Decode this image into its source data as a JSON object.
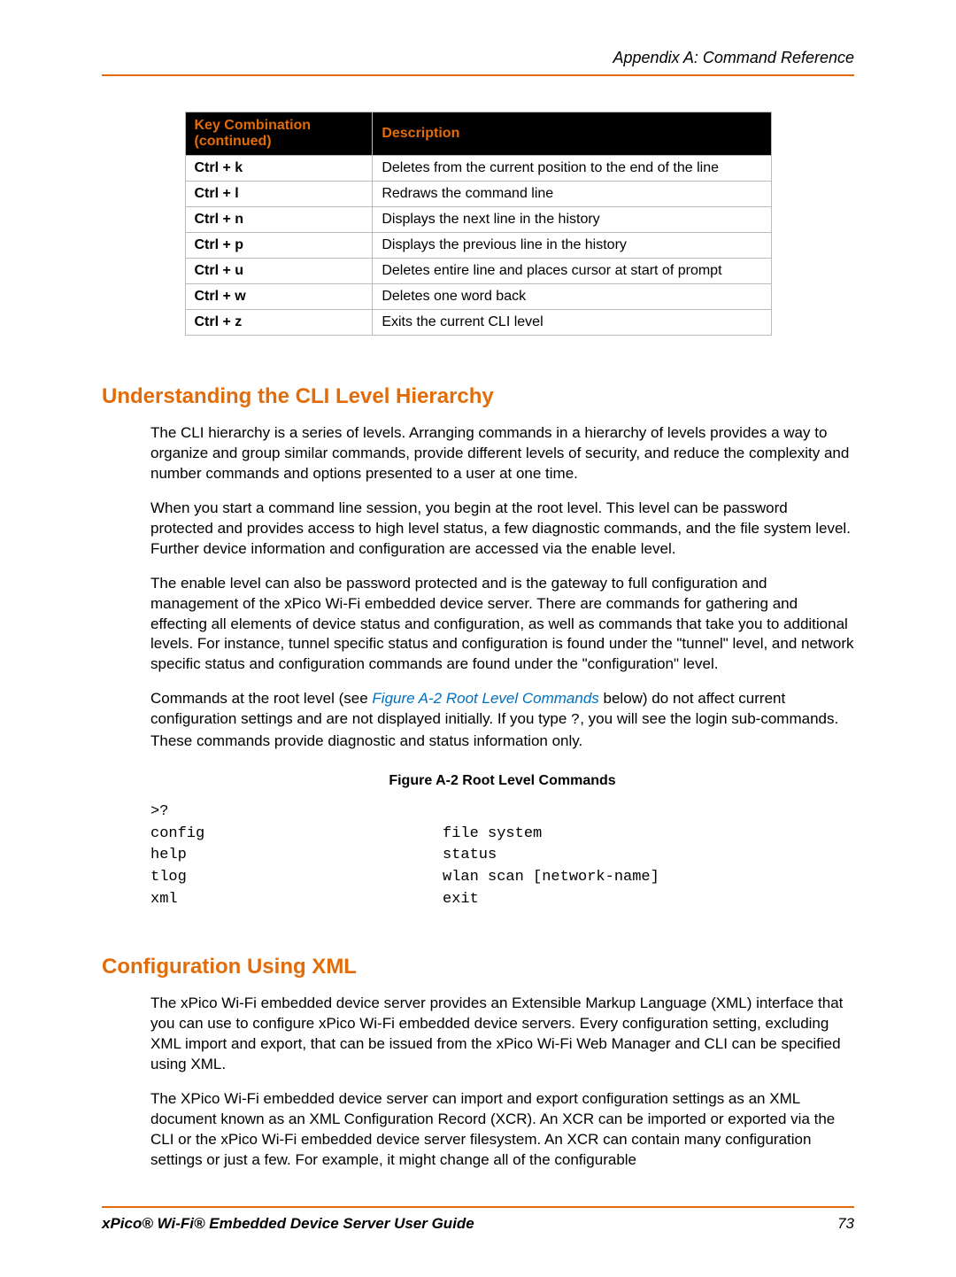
{
  "header": {
    "appendix": "Appendix A: Command Reference"
  },
  "table": {
    "col1": "Key Combination (continued)",
    "col2": "Description",
    "rows": [
      {
        "k": "Ctrl + k",
        "d": "Deletes from the current position to the end of the line"
      },
      {
        "k": "Ctrl + l",
        "d": "Redraws the command line"
      },
      {
        "k": "Ctrl + n",
        "d": "Displays the next line in the history"
      },
      {
        "k": "Ctrl + p",
        "d": "Displays the previous line in the history"
      },
      {
        "k": "Ctrl + u",
        "d": "Deletes entire line and places cursor at start of prompt"
      },
      {
        "k": "Ctrl + w",
        "d": "Deletes one word back"
      },
      {
        "k": "Ctrl + z",
        "d": "Exits the current CLI level"
      }
    ]
  },
  "section1": {
    "heading": "Understanding the CLI Level Hierarchy",
    "p1": "The CLI hierarchy is a series of levels. Arranging commands in a hierarchy of levels provides a way to organize and group similar commands, provide different levels of security, and reduce the complexity and number commands and options presented to a user at one time.",
    "p2": "When you start a command line session, you begin at the root level. This level can be password protected and provides access to high level status, a few diagnostic commands, and the file system level. Further device information and configuration are accessed via the enable level.",
    "p3": "The enable level can also be password protected and is the gateway to full configuration and management of the xPico Wi-Fi embedded device server. There are commands for gathering and effecting all elements of device status and configuration, as well as commands that take you to additional levels. For instance, tunnel specific status and configuration is found under the \"tunnel\" level, and network specific status and configuration commands are found under the \"configuration\" level.",
    "p4a": "Commands at the root level (see ",
    "p4link": "Figure A-2 Root Level Commands",
    "p4b": " below) do not affect current configuration settings and are not displayed initially. If you type ",
    "p4q": "?",
    "p4c": ", you will see the login sub-commands. These commands provide diagnostic and status information only."
  },
  "figure": {
    "caption": "Figure A-2  Root Level Commands",
    "prompt": ">?",
    "left": [
      "config",
      "help",
      "tlog",
      "xml"
    ],
    "right": [
      "file system",
      "status",
      "wlan scan [network-name]",
      "exit"
    ]
  },
  "section2": {
    "heading": "Configuration Using XML",
    "p1": "The xPico Wi-Fi embedded device server provides an Extensible Markup Language (XML) interface that you can use to configure xPico Wi-Fi embedded device servers. Every configuration setting, excluding XML import and export, that can be issued from the xPico Wi-Fi Web Manager and CLI can be specified using XML.",
    "p2": "The XPico Wi-Fi embedded device server can import and export configuration settings as an XML document known as an XML Configuration Record (XCR). An XCR can be imported or exported via the CLI or the xPico Wi-Fi embedded device server filesystem. An XCR can contain many configuration settings or just a few. For example, it might change all of the configurable"
  },
  "footer": {
    "guide": "xPico® Wi-Fi® Embedded Device Server User Guide",
    "page": "73"
  }
}
